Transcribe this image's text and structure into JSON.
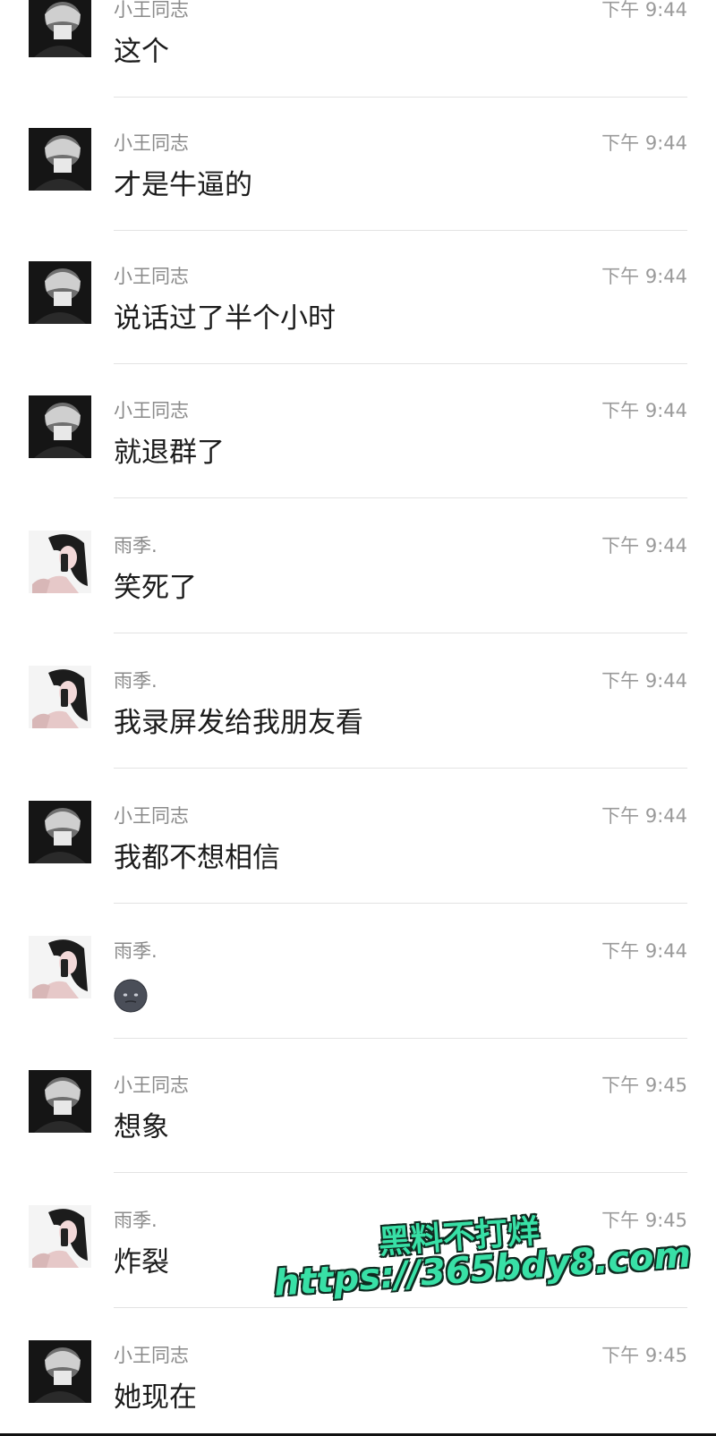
{
  "messages": [
    {
      "sender": "小王同志",
      "time": "下午 9:44",
      "text": "这个",
      "avatar": "boy-avatar"
    },
    {
      "sender": "小王同志",
      "time": "下午 9:44",
      "text": "才是牛逼的",
      "avatar": "boy-avatar"
    },
    {
      "sender": "小王同志",
      "time": "下午 9:44",
      "text": "说话过了半个小时",
      "avatar": "boy-avatar"
    },
    {
      "sender": "小王同志",
      "time": "下午 9:44",
      "text": "就退群了",
      "avatar": "boy-avatar"
    },
    {
      "sender": "雨季.",
      "time": "下午 9:44",
      "text": "笑死了",
      "avatar": "girl-avatar"
    },
    {
      "sender": "雨季.",
      "time": "下午 9:44",
      "text": "我录屏发给我朋友看",
      "avatar": "girl-avatar"
    },
    {
      "sender": "小王同志",
      "time": "下午 9:44",
      "text": "我都不想相信",
      "avatar": "boy-avatar"
    },
    {
      "sender": "雨季.",
      "time": "下午 9:44",
      "text": "",
      "emoji": "dark-face-emoji",
      "avatar": "girl-avatar"
    },
    {
      "sender": "小王同志",
      "time": "下午 9:45",
      "text": "想象",
      "avatar": "boy-avatar"
    },
    {
      "sender": "雨季.",
      "time": "下午 9:45",
      "text": "炸裂",
      "avatar": "girl-avatar"
    },
    {
      "sender": "小王同志",
      "time": "下午 9:45",
      "text": "她现在",
      "avatar": "boy-avatar"
    }
  ],
  "watermark": {
    "line1": "黑料不打烊",
    "line2": "https://365bdy8.com",
    "color": "#38e0a6"
  }
}
